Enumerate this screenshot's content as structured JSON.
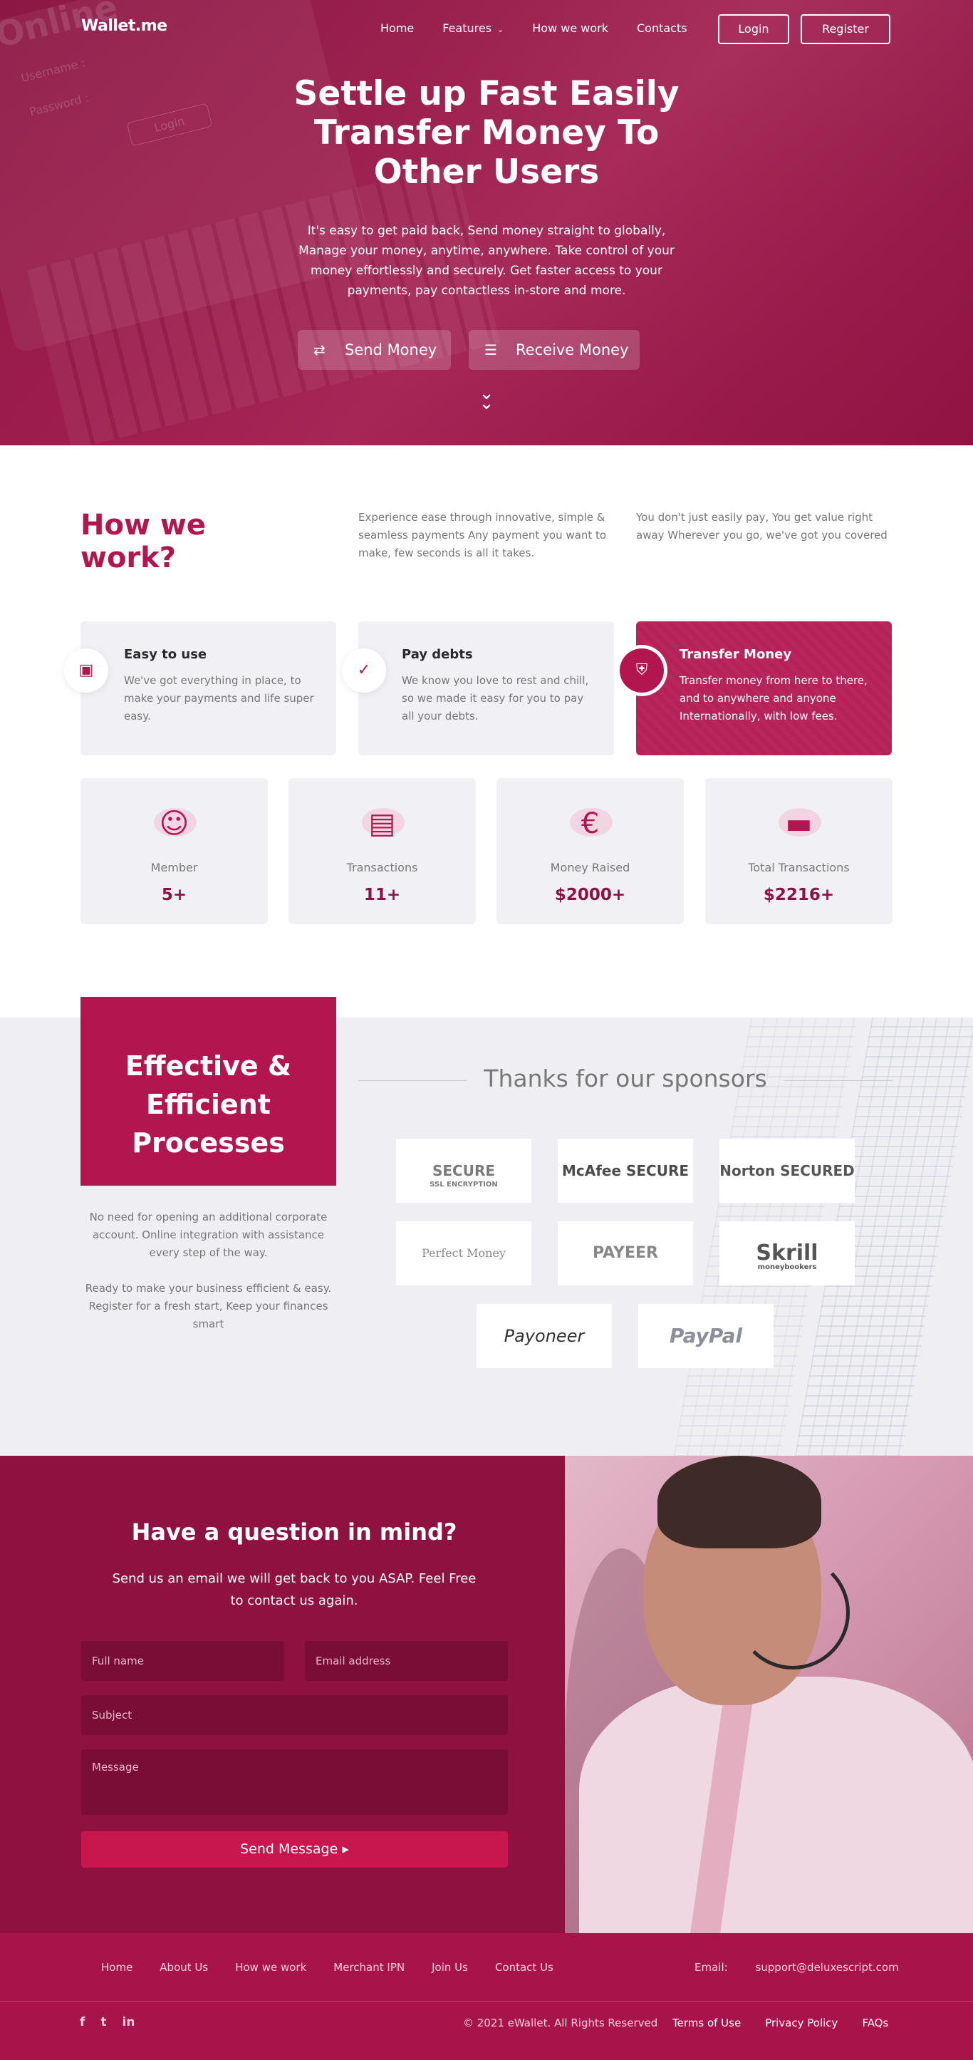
{
  "brand": "Wallet.me",
  "nav": {
    "links": [
      "Home",
      "Features",
      "How we work",
      "Contacts"
    ],
    "login": "Login",
    "register": "Register"
  },
  "hero": {
    "title": "Settle up Fast Easily Transfer Money To Other Users",
    "text": "It's easy to get paid back, Send money straight to globally, Manage your money, anytime, anywhere. Take control of your money effortlessly and securely. Get faster access to your payments, pay contactless in-store and more.",
    "send_button": "Send Money",
    "receive_button": "Receive Money",
    "bg_text": {
      "online": "Online",
      "username": "Username :",
      "password": "Password :",
      "login": "Login"
    }
  },
  "how_we_work": {
    "title": "How we work?",
    "para1": "Experience ease through innovative, simple & seamless payments Any payment you want to make, few seconds is all it takes.",
    "para2": "You don't just easily pay, You get value right away Wherever you go, we've got you covered"
  },
  "features": [
    {
      "title": "Easy to use",
      "text": "We've got everything in place, to make your payments and life super easy.",
      "icon": "briefcase-icon"
    },
    {
      "title": "Pay debts",
      "text": "We know you love to rest and chill, so we made it easy for you to pay all your debts.",
      "icon": "check-icon"
    },
    {
      "title": "Transfer Money",
      "text": "Transfer money from here to there, and to anywhere and anyone Internationally, with low fees.",
      "icon": "shield-icon"
    }
  ],
  "stats": [
    {
      "label": "Member",
      "value": "5+",
      "icon": "member-icon"
    },
    {
      "label": "Transactions",
      "value": "11+",
      "icon": "wallet-icon"
    },
    {
      "label": "Money Raised",
      "value": "$2000+",
      "icon": "money-bag-icon"
    },
    {
      "label": "Total Transactions",
      "value": "$2216+",
      "icon": "card-coins-icon"
    }
  ],
  "efficient": {
    "title": "Effective & Efficient Processes",
    "para1": "No need for opening an additional corporate account. Online integration with assistance every step of the way.",
    "para2": "Ready to make your business efficient & easy. Register for a fresh start, Keep your finances smart"
  },
  "sponsors": {
    "title": "Thanks for our sponsors",
    "logos": [
      {
        "name": "SECURE",
        "sub": "SSL ENCRYPTION"
      },
      {
        "name": "McAfee SECURE",
        "sub": ""
      },
      {
        "name": "Norton SECURED",
        "sub": ""
      },
      {
        "name": "Perfect Money",
        "sub": ""
      },
      {
        "name": "PAYEER",
        "sub": ""
      },
      {
        "name": "Skrill",
        "sub": "moneybookers"
      },
      {
        "name": "Payoneer",
        "sub": ""
      },
      {
        "name": "PayPal",
        "sub": ""
      }
    ]
  },
  "contact": {
    "title": "Have a question in mind?",
    "text": "Send us an email we will get back to you ASAP. Feel Free to contact us again.",
    "placeholders": {
      "name": "Full name",
      "email": "Email address",
      "subject": "Subject",
      "message": "Message"
    },
    "send_button": "Send Message ▸"
  },
  "footer": {
    "links": [
      "Home",
      "About Us",
      "How we work",
      "Merchant IPN",
      "Join Us",
      "Contact Us"
    ],
    "email_label": "Email:",
    "email": "support@deluxescript.com",
    "social": [
      "f",
      "t",
      "in"
    ],
    "copyright": "© 2021 eWallet. All Rights Reserved",
    "legal": [
      "Terms of Use",
      "Privacy Policy",
      "FAQs"
    ]
  },
  "colors": {
    "primary": "#b3154f",
    "dark": "#8e1140",
    "footer": "#a8144a",
    "panel": "#f1f0f4"
  }
}
